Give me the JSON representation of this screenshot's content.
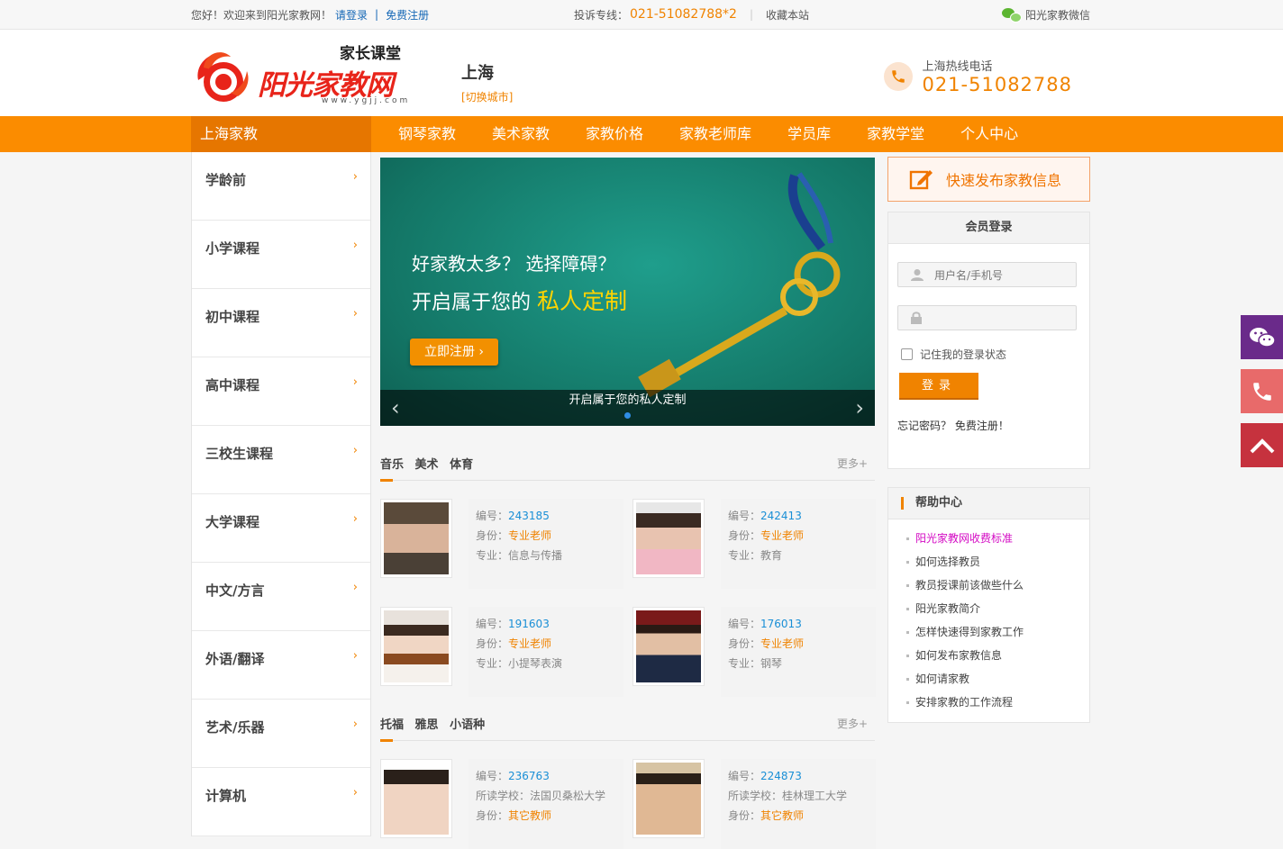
{
  "topbar": {
    "greeting": "您好！欢迎来到阳光家教网！",
    "login_link": "请登录",
    "separator": "|",
    "register_link": "免费注册",
    "complaint_label": "投诉专线：",
    "complaint_phone": "021-51082788*2",
    "bookmark": "收藏本站",
    "wechat": "阳光家教微信"
  },
  "header": {
    "logo_tagline": "家长课堂",
    "logo_brand": "阳光家教网",
    "logo_url": "www.ygjj.com",
    "city": "上海",
    "switch_city": "[切换城市]",
    "hotline_label": "上海热线电话",
    "hotline_number": "021-51082788"
  },
  "nav": {
    "home": "上海家教",
    "items": [
      "钢琴家教",
      "美术家教",
      "家教价格",
      "家教老师库",
      "学员库",
      "家教学堂",
      "个人中心"
    ]
  },
  "sidebar": {
    "arrow": "›",
    "categories": [
      "学龄前",
      "小学课程",
      "初中课程",
      "高中课程",
      "三校生课程",
      "大学课程",
      "中文/方言",
      "外语/翻译",
      "艺术/乐器",
      "计算机"
    ]
  },
  "banner": {
    "line1": "好家教太多？ 选择障碍？",
    "line2_prefix": "开启属于您的",
    "line2_highlight": "私人定制",
    "register_button": "立即注册  ›",
    "caption": "开启属于您的私人定制",
    "prev": "‹",
    "next": "›"
  },
  "section1": {
    "title_parts": [
      "音乐",
      "美术",
      "体育"
    ],
    "more": "更多+",
    "teachers": [
      {
        "no_label": "编号：",
        "no": "243185",
        "id_label": "身份：",
        "id": "专业老师",
        "c_label": "专业：",
        "c": "信息与传播"
      },
      {
        "no_label": "编号：",
        "no": "242413",
        "id_label": "身份：",
        "id": "专业老师",
        "c_label": "专业：",
        "c": "教育"
      },
      {
        "no_label": "编号：",
        "no": "191603",
        "id_label": "身份：",
        "id": "专业老师",
        "c_label": "专业：",
        "c": "小提琴表演"
      },
      {
        "no_label": "编号：",
        "no": "176013",
        "id_label": "身份：",
        "id": "专业老师",
        "c_label": "专业：",
        "c": "钢琴"
      }
    ]
  },
  "section2": {
    "title_parts": [
      "托福",
      "雅思",
      "小语种"
    ],
    "more": "更多+",
    "teachers": [
      {
        "no_label": "编号：",
        "no": "236763",
        "school_label": "所读学校：",
        "school": "法国贝桑松大学",
        "id_label": "身份：",
        "id": "其它教师"
      },
      {
        "no_label": "编号：",
        "no": "224873",
        "school_label": "所读学校：",
        "school": "桂林理工大学",
        "id_label": "身份：",
        "id": "其它教师"
      }
    ]
  },
  "publish": {
    "label": "快速发布家教信息"
  },
  "login": {
    "title": "会员登录",
    "username_placeholder": "用户名/手机号",
    "password_placeholder": "",
    "remember": "记住我的登录状态",
    "submit": "登录",
    "forgot": "忘记密码？",
    "register": "免费注册！"
  },
  "help": {
    "title": "帮助中心",
    "items": [
      "阳光家教网收费标准",
      "如何选择教员",
      "教员授课前该做些什么",
      "阳光家教简介",
      "怎样快速得到家教工作",
      "如何发布家教信息",
      "如何请家教",
      "安排家教的工作流程"
    ]
  },
  "colors": {
    "accent": "#f08300",
    "nav": "#fb8c00",
    "link": "#1668b6",
    "wechat_float": "#6a2a8a",
    "phone_float": "#e86a6a",
    "top_float": "#c6323e"
  }
}
